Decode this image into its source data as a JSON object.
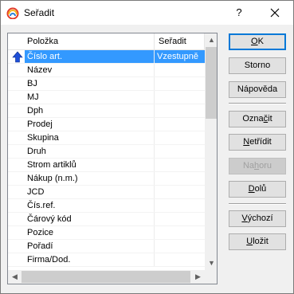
{
  "window": {
    "title": "Seřadit",
    "help_label": "?"
  },
  "list": {
    "headers": [
      "Položka",
      "Seřadit"
    ],
    "rows": [
      {
        "item": "Číslo art.",
        "sort": "Vzestupně",
        "selected": true,
        "icon": "up-arrow-icon"
      },
      {
        "item": "Název",
        "sort": ""
      },
      {
        "item": "BJ",
        "sort": ""
      },
      {
        "item": "MJ",
        "sort": ""
      },
      {
        "item": "Dph",
        "sort": ""
      },
      {
        "item": "Prodej",
        "sort": ""
      },
      {
        "item": "Skupina",
        "sort": ""
      },
      {
        "item": "Druh",
        "sort": ""
      },
      {
        "item": "Strom artiklů",
        "sort": ""
      },
      {
        "item": "Nákup (n.m.)",
        "sort": ""
      },
      {
        "item": "JCD",
        "sort": ""
      },
      {
        "item": "Čís.ref.",
        "sort": ""
      },
      {
        "item": "Čárový kód",
        "sort": ""
      },
      {
        "item": "Pozice",
        "sort": ""
      },
      {
        "item": "Pořadí",
        "sort": ""
      },
      {
        "item": "Firma/Dod.",
        "sort": ""
      }
    ]
  },
  "buttons": {
    "ok": {
      "first": "O",
      "rest": "K"
    },
    "storno": "Storno",
    "napoveda": "Nápověda",
    "oznacit": {
      "pre": "Ozna",
      "u": "č",
      "post": "it"
    },
    "netridit": {
      "pre": "",
      "u": "N",
      "post": "etřídit"
    },
    "nahoru": {
      "pre": "Na",
      "u": "h",
      "post": "oru"
    },
    "dolu": {
      "pre": "",
      "u": "D",
      "post": "olů"
    },
    "vychozi": {
      "pre": "",
      "u": "V",
      "post": "ýchozí"
    },
    "ulozit": {
      "pre": "",
      "u": "U",
      "post": "ložit"
    }
  },
  "colors": {
    "selection": "#3399ff",
    "accent": "#0078d7"
  }
}
